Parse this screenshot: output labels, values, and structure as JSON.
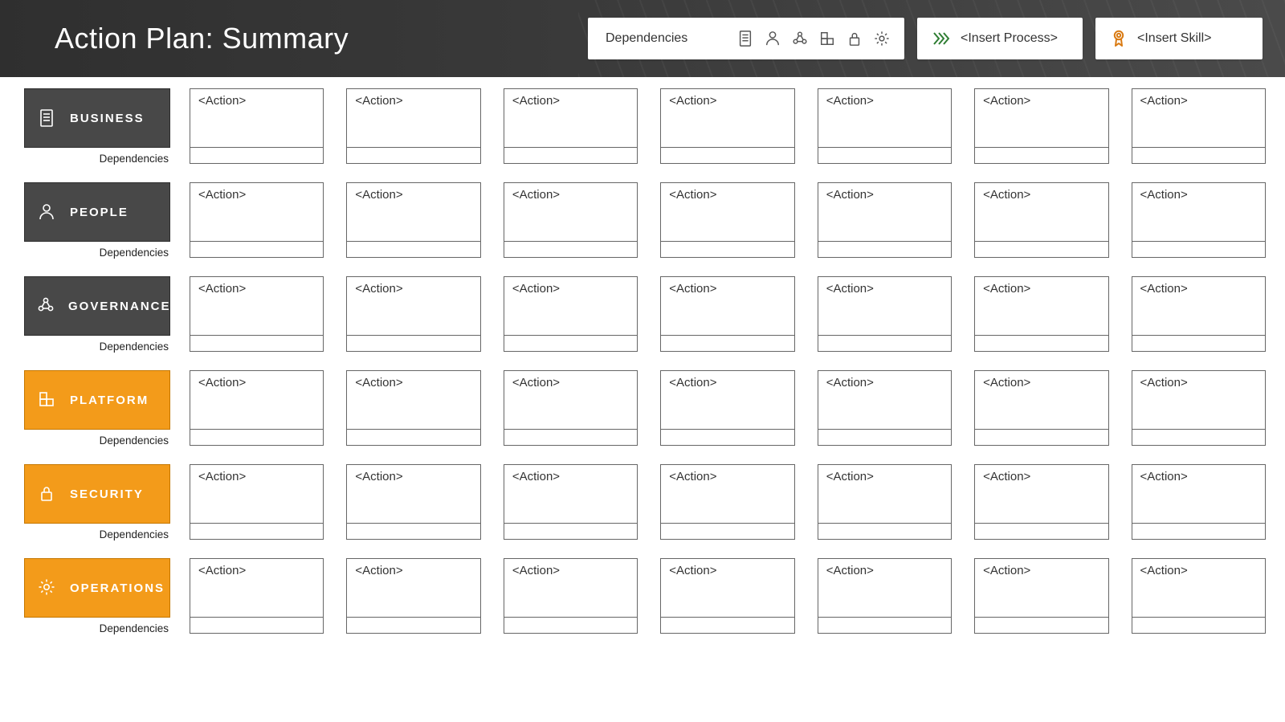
{
  "header": {
    "title": "Action Plan: Summary",
    "dependencies_label": "Dependencies",
    "process_label": "<Insert Process>",
    "skill_label": "<Insert Skill>"
  },
  "dep_icons": [
    "document-icon",
    "person-icon",
    "nodes-icon",
    "platform-icon",
    "lock-icon",
    "gear-icon"
  ],
  "dep_small_label": "Dependencies",
  "action_placeholder": "<Action>",
  "colors": {
    "dark_row_bg": "#484848",
    "orange_row_bg": "#f39b1a",
    "header_gradient_from": "#2f2f2f",
    "header_gradient_to": "#4a4a4a"
  },
  "rows": [
    {
      "id": "business",
      "label": "BUSINESS",
      "icon": "document-icon",
      "style": "dark"
    },
    {
      "id": "people",
      "label": "PEOPLE",
      "icon": "person-icon",
      "style": "dark"
    },
    {
      "id": "governance",
      "label": "GOVERNANCE",
      "icon": "nodes-icon",
      "style": "dark"
    },
    {
      "id": "platform",
      "label": "PLATFORM",
      "icon": "platform-icon",
      "style": "orange"
    },
    {
      "id": "security",
      "label": "SECURITY",
      "icon": "lock-icon",
      "style": "orange"
    },
    {
      "id": "operations",
      "label": "OPERATIONS",
      "icon": "gear-icon",
      "style": "orange"
    }
  ],
  "actions_per_row": 7
}
